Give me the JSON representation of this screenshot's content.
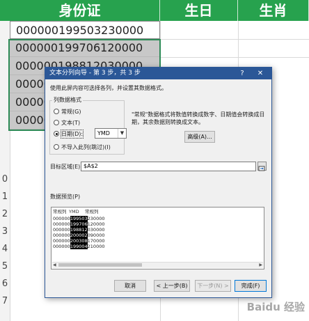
{
  "sheet": {
    "headers": [
      "身份证",
      "生日",
      "生肖"
    ],
    "ids": [
      "000000199503230000",
      "000000199706120000",
      "000000198812030000",
      "000000200002090000",
      "000000200308170000",
      "000000199004210000"
    ],
    "row_numbers": [
      "0",
      "1",
      "2",
      "3",
      "4",
      "5",
      "6",
      "7"
    ],
    "header_color": "#27a24e"
  },
  "dialog": {
    "title": "文本分列向导 - 第 3 步，共 3 步",
    "help_glyph": "?",
    "close_glyph": "✕",
    "description": "使用此屏内容可选择各列，并设置其数据格式。",
    "column_format_label": "列数据格式",
    "radio_options": [
      "常规(G)",
      "文本(T)",
      "日期(D):",
      "不导入此列(跳过)(I)"
    ],
    "selected_radio": "日期(D):",
    "date_format": "YMD",
    "note": "\"常规\"数据格式将数值转换成数字、日期值会转换成日期，其余数据则转换成文本。",
    "advanced_button": "高级(A)...",
    "target_label": "目标区域(E):",
    "target_value": "$A$2",
    "preview_label": "数据预览(P)",
    "preview_headers": [
      "常规列",
      "YMD",
      "常规列"
    ],
    "preview_rows": [
      {
        "a": "000000",
        "b": "199503",
        "c": "230000"
      },
      {
        "a": "000000",
        "b": "199706",
        "c": "120000"
      },
      {
        "a": "000000",
        "b": "198812",
        "c": "030000"
      },
      {
        "a": "000000",
        "b": "200002",
        "c": "090000"
      },
      {
        "a": "000000",
        "b": "200308",
        "c": "170000"
      },
      {
        "a": "000000",
        "b": "199004",
        "c": "210000"
      }
    ],
    "buttons": {
      "cancel": "取消",
      "back": "< 上一步(B)",
      "next": "下一步(N) >",
      "finish": "完成(F)"
    }
  },
  "watermark": "Baidu 经验",
  "accent_color": "#2b5797"
}
